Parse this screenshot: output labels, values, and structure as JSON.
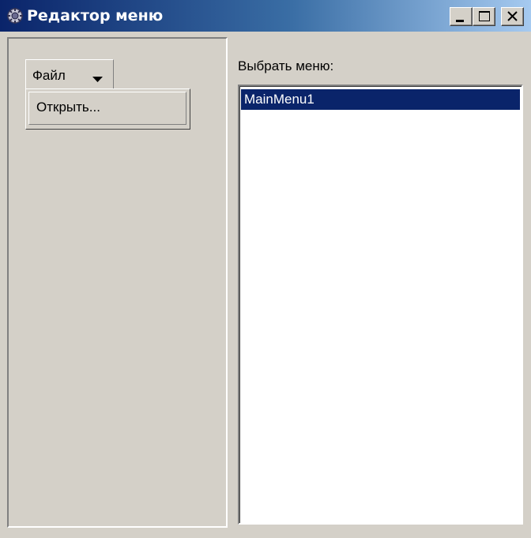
{
  "window": {
    "title": "Редактор меню",
    "title_icon": "gear-app-icon",
    "controls": [
      "minimize-icon",
      "maximize-icon",
      "close-icon"
    ]
  },
  "menubar": {
    "file_label": "Файл",
    "file_arrow_icon": "caret-down-icon"
  },
  "dropdown": {
    "items": [
      {
        "label": "Открыть..."
      }
    ]
  },
  "selector": {
    "label": "Выбрать меню:",
    "items": [
      {
        "label": "MainMenu1",
        "selected": true
      }
    ]
  },
  "colors": {
    "titlebar_start": "#0a246a",
    "titlebar_end": "#a6caf0",
    "face": "#d4d0c8",
    "selection": "#0a246a"
  }
}
